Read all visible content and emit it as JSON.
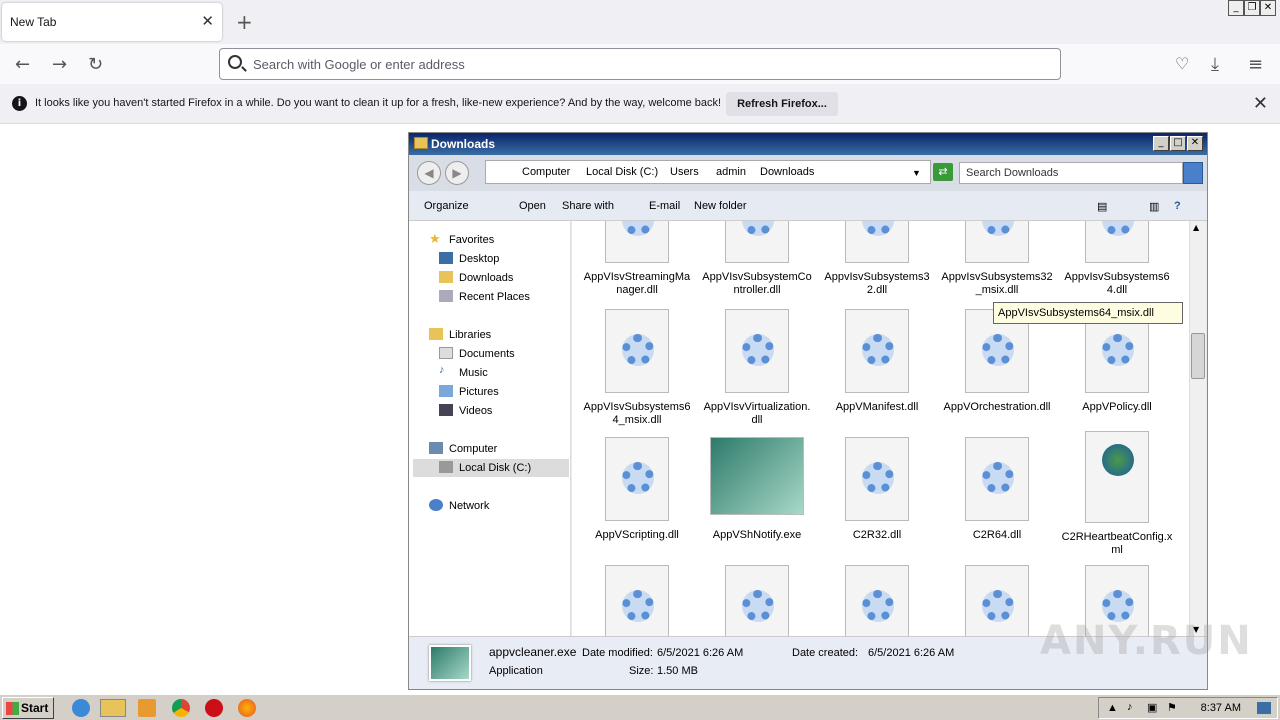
{
  "browser": {
    "tab_title": "New Tab",
    "url_placeholder": "Search with Google or enter address",
    "notice_text": "It looks like you haven't started Firefox in a while. Do you want to clean it up for a fresh, like-new experience? And by the way, welcome back!",
    "notice_button": "Refresh Firefox..."
  },
  "explorer": {
    "title": "Downloads",
    "breadcrumbs": [
      "Computer",
      "Local Disk (C:)",
      "Users",
      "admin",
      "Downloads"
    ],
    "search_placeholder": "Search Downloads",
    "toolbar": [
      "Organize",
      "Open",
      "Share with",
      "E-mail",
      "New folder"
    ],
    "sidebar": {
      "favorites": "Favorites",
      "fav_items": [
        "Desktop",
        "Downloads",
        "Recent Places"
      ],
      "libraries": "Libraries",
      "lib_items": [
        "Documents",
        "Music",
        "Pictures",
        "Videos"
      ],
      "computer": "Computer",
      "computer_items": [
        "Local Disk (C:)"
      ],
      "network": "Network"
    },
    "files_row1": [
      "AppVIsvStreamingManager.dll",
      "AppVIsvSubsystemController.dll",
      "AppvIsvSubsystems32.dll",
      "AppvIsvSubsystems32_msix.dll",
      "AppvIsvSubsystems64.dll"
    ],
    "files_row2": [
      "AppVIsvSubsystems64_msix.dll",
      "AppVIsvVirtualization.dll",
      "AppVManifest.dll",
      "AppVOrchestration.dll",
      "AppVPolicy.dll"
    ],
    "files_row3": [
      "AppVScripting.dll",
      "AppVShNotify.exe",
      "C2R32.dll",
      "C2R64.dll",
      "C2RHeartbeatConfig.xml"
    ],
    "tooltip": "AppVIsvSubsystems64_msix.dll",
    "details": {
      "name": "appvcleaner.exe",
      "type": "Application",
      "modified_label": "Date modified:",
      "modified": "6/5/2021 6:26 AM",
      "created_label": "Date created:",
      "created": "6/5/2021 6:26 AM",
      "size_label": "Size:",
      "size": "1.50 MB"
    }
  },
  "taskbar": {
    "start": "Start",
    "clock": "8:37 AM"
  },
  "watermark": "ANY.RUN"
}
